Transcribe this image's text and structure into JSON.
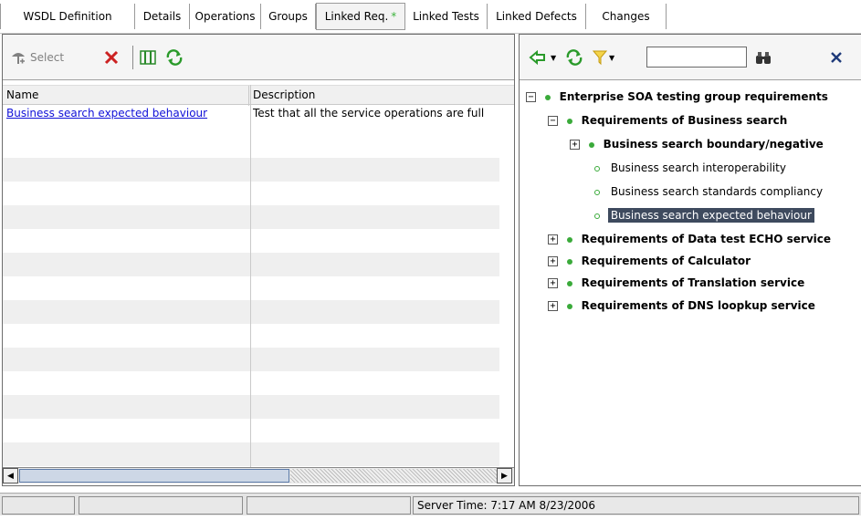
{
  "tabs": [
    {
      "label": "WSDL Definition"
    },
    {
      "label": "Details"
    },
    {
      "label": "Operations"
    },
    {
      "label": "Groups"
    },
    {
      "label": "Linked Req.",
      "active": true,
      "indicator": "*"
    },
    {
      "label": "Linked Tests"
    },
    {
      "label": "Linked Defects"
    },
    {
      "label": "Changes"
    }
  ],
  "left_toolbar": {
    "select_label": "Select"
  },
  "grid": {
    "columns": [
      "Name",
      "Description"
    ],
    "rows": [
      {
        "name": "Business search expected behaviour",
        "description": "Test that all the service operations are full"
      }
    ]
  },
  "right_toolbar": {
    "filter_value": ""
  },
  "tree": {
    "root": "Enterprise SOA testing group requirements",
    "n1": "Requirements of Business search",
    "n1a": "Business search boundary/negative",
    "n1b": "Business search interoperability",
    "n1c": "Business search standards compliancy",
    "n1d": "Business search expected behaviour",
    "n2": "Requirements of Data test ECHO service",
    "n3": "Requirements of Calculator",
    "n4": "Requirements of Translation service",
    "n5": "Requirements of DNS loopkup service"
  },
  "status": {
    "server_time": "Server Time: 7:17 AM 8/23/2006"
  },
  "colors": {
    "accent_green": "#3aaa3a",
    "link": "#1010d8",
    "selection": "#3e4a5e",
    "delete_red": "#cc2222"
  }
}
